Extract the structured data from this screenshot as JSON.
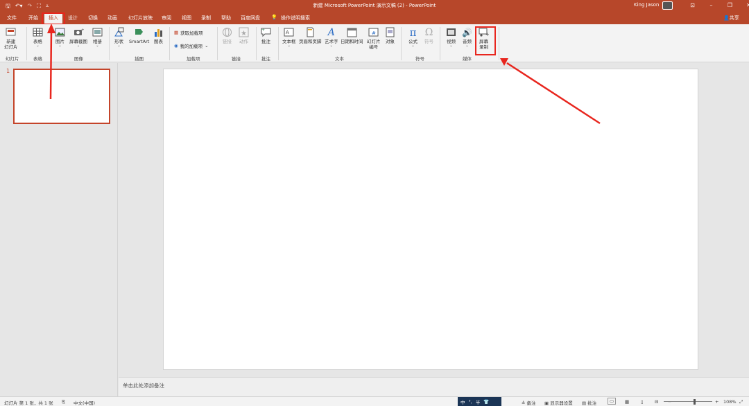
{
  "titlebar": {
    "title": "新建 Microsoft PowerPoint 演示文稿 (2)  -  PowerPoint",
    "user": "King Jason",
    "qat_icons": [
      "save-icon",
      "undo-icon",
      "redo-icon",
      "present-icon",
      "customize-icon"
    ],
    "window_buttons": [
      "ribbon-display-icon",
      "minimize-icon",
      "restore-icon",
      "close-icon"
    ]
  },
  "menu": {
    "tabs": [
      "文件",
      "开始",
      "插入",
      "设计",
      "切换",
      "动画",
      "幻灯片放映",
      "审阅",
      "视图",
      "录制",
      "帮助",
      "百度网盘",
      "操作说明搜索"
    ],
    "active": "插入",
    "share": "共享"
  },
  "ribbon": {
    "groups": {
      "slides": "幻灯片",
      "tables": "表格",
      "images": "图像",
      "illustrations": "插图",
      "addins": "加载项",
      "links": "链接",
      "comments": "批注",
      "text": "文本",
      "symbols": "符号",
      "media": "媒体"
    },
    "buttons": {
      "new_slide": "新建\n幻灯片",
      "table": "表格",
      "pictures": "图片",
      "screenshot": "屏幕截图",
      "album": "相册",
      "shapes": "形状",
      "smartart": "SmartArt",
      "chart": "图表",
      "get_addins": "获取加载项",
      "my_addins": "我的加载项",
      "link": "链接",
      "action": "动作",
      "comment": "批注",
      "textbox": "文本框",
      "header_footer": "页眉和页脚",
      "wordart": "艺术字",
      "datetime": "日期和时间",
      "slide_number": "幻灯片\n编号",
      "object": "对象",
      "equation": "公式",
      "symbol": "符号",
      "video": "视频",
      "audio": "音频",
      "screen_recording": "屏幕\n录制"
    }
  },
  "thumbnails": {
    "slide_number": "1"
  },
  "notes": {
    "placeholder": "单击此处添加备注"
  },
  "status": {
    "slide_info": "幻灯片 第 1 张，共 1 张",
    "language": "中文(中国)",
    "ime": [
      "中",
      "°,",
      "半"
    ],
    "notes_btn": "备注",
    "display_settings": "显示器设置",
    "comments_btn": "批注",
    "zoom": "108%",
    "zoom_minus": "−",
    "zoom_plus": "+"
  },
  "colors": {
    "accent": "#b7472a",
    "annotation": "#e8261e",
    "equation_blue": "#2b6cc4"
  }
}
